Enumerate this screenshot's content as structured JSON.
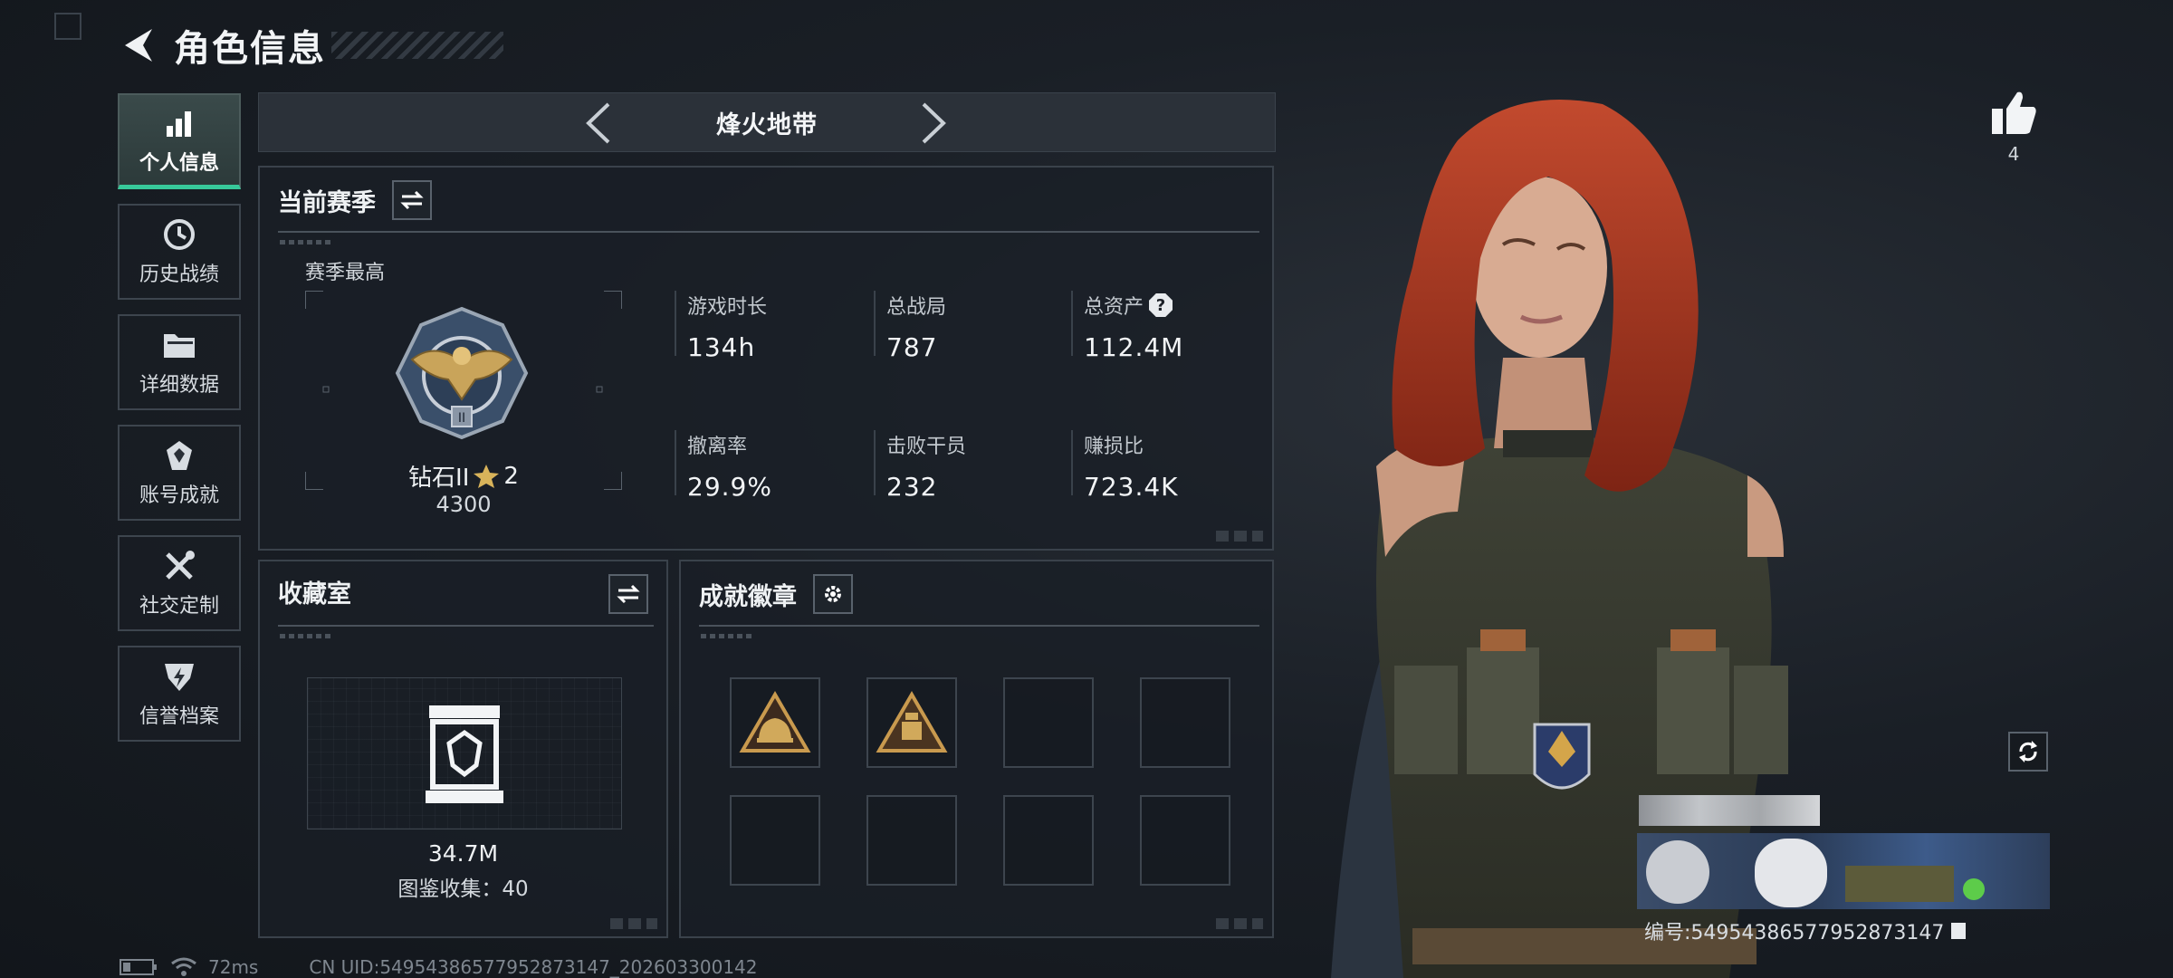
{
  "header": {
    "title": "角色信息"
  },
  "nav": [
    {
      "label": "个人信息",
      "icon": "bar-chart-icon",
      "active": true
    },
    {
      "label": "历史战绩",
      "icon": "history-icon"
    },
    {
      "label": "详细数据",
      "icon": "folder-icon"
    },
    {
      "label": "账号成就",
      "icon": "achievement-icon"
    },
    {
      "label": "社交定制",
      "icon": "tools-icon"
    },
    {
      "label": "信誉档案",
      "icon": "credit-icon"
    }
  ],
  "mode": {
    "name": "烽火地带"
  },
  "season": {
    "title": "当前赛季",
    "highest_label": "赛季最高",
    "rank_name": "钻石II",
    "rank_stars": "2",
    "rank_score": "4300",
    "stats": [
      {
        "label": "游戏时长",
        "value": "134h"
      },
      {
        "label": "总战局",
        "value": "787"
      },
      {
        "label": "总资产",
        "value": "112.4M",
        "help": "?"
      },
      {
        "label": "撤离率",
        "value": "29.9%"
      },
      {
        "label": "击败干员",
        "value": "232"
      },
      {
        "label": "赚损比",
        "value": "723.4K"
      }
    ]
  },
  "collection": {
    "title": "收藏室",
    "value": "34.7M",
    "catalog_label": "图鉴收集：40"
  },
  "badges": {
    "title": "成就徽章",
    "slots": 8,
    "filled": 2
  },
  "likes": {
    "count": "4"
  },
  "player": {
    "id_text": "编号:5495438657795287314​7"
  },
  "status": {
    "ping": "72ms",
    "uid": "CN UID:5495438657795287314​7_202603300142"
  },
  "colors": {
    "accent": "#37c99a",
    "panel_border": "#3a424b",
    "hair": "#a8321f"
  }
}
